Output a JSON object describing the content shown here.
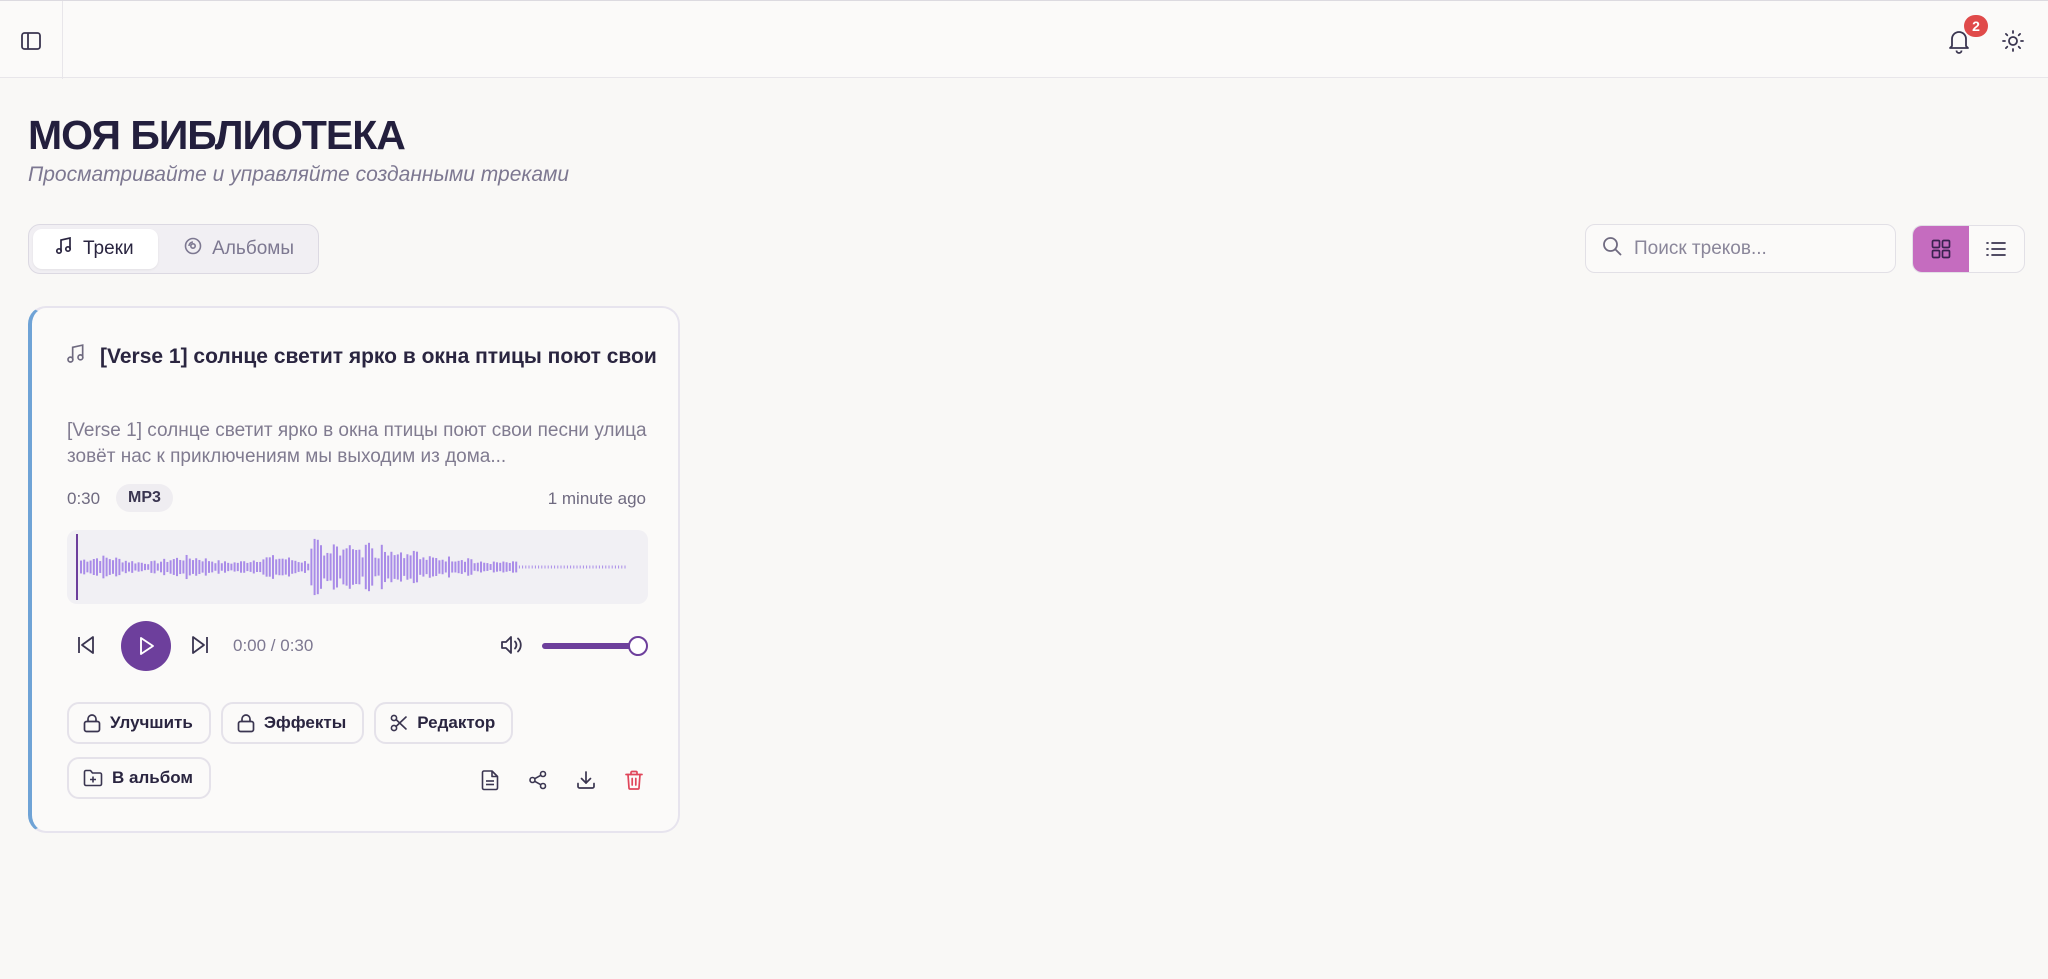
{
  "header": {
    "notifications_count": "2"
  },
  "page": {
    "title": "МОЯ БИБЛИОТЕКА",
    "subtitle": "Просматривайте и управляйте созданными треками"
  },
  "tabs": [
    {
      "label": "Треки",
      "icon": "music-note-icon",
      "active": true
    },
    {
      "label": "Альбомы",
      "icon": "disc-icon",
      "active": false
    }
  ],
  "search": {
    "placeholder": "Поиск треков...",
    "value": ""
  },
  "view": {
    "active": "grid",
    "options": [
      "grid",
      "list"
    ]
  },
  "track": {
    "title": "[Verse 1] солнце светит ярко в окна птицы поют свои",
    "description": "[Verse 1] солнце светит ярко в окна птицы поют свои песни улица зовёт нас к приключениям мы выходим из дома...",
    "duration": "0:30",
    "format": "MP3",
    "created": "1 minute ago",
    "time_readout": "0:00 / 0:30",
    "volume": 1.0,
    "progress": 0.0
  },
  "actions": {
    "enhance": "Улучшить",
    "effects": "Эффекты",
    "editor": "Редактор",
    "to_album": "В альбом"
  },
  "colors": {
    "accent": "#6d3f9c",
    "waveform": "#a98be8",
    "active_view": "#c56cbf",
    "card_border_left": "#6fa3d6",
    "delete": "#e0455a",
    "badge": "#e04a4a"
  }
}
